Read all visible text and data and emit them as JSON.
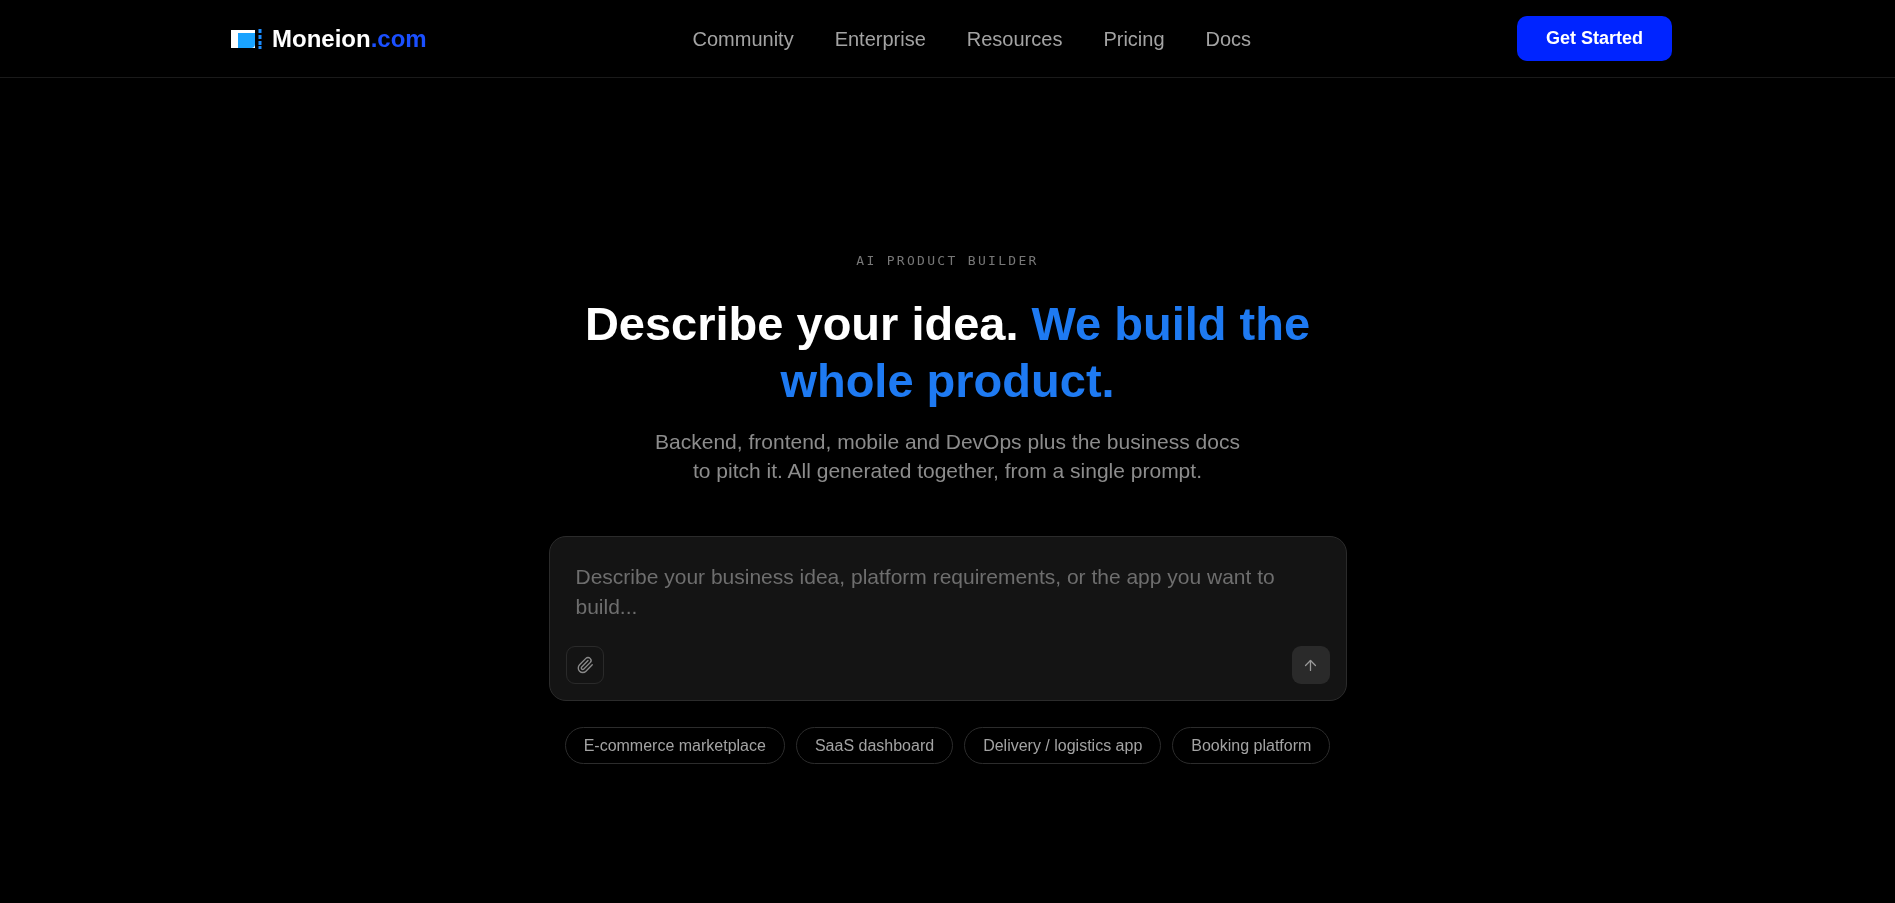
{
  "header": {
    "logo": {
      "name": "Moneion",
      "suffix": ".com"
    },
    "nav": [
      "Community",
      "Enterprise",
      "Resources",
      "Pricing",
      "Docs"
    ],
    "cta": "Get Started"
  },
  "hero": {
    "eyebrow": "AI PRODUCT BUILDER",
    "title": "Describe your idea.",
    "title_highlight": "We build the whole product.",
    "subtitle": "Backend, frontend, mobile and DevOps plus the business docs to pitch it. All generated together, from a single prompt."
  },
  "composer": {
    "placeholder": "Describe your business idea, platform requirements, or the app you want to build..."
  },
  "suggestions": [
    "E-commerce marketplace",
    "SaaS dashboard",
    "Delivery / logistics app",
    "Booking platform"
  ]
}
